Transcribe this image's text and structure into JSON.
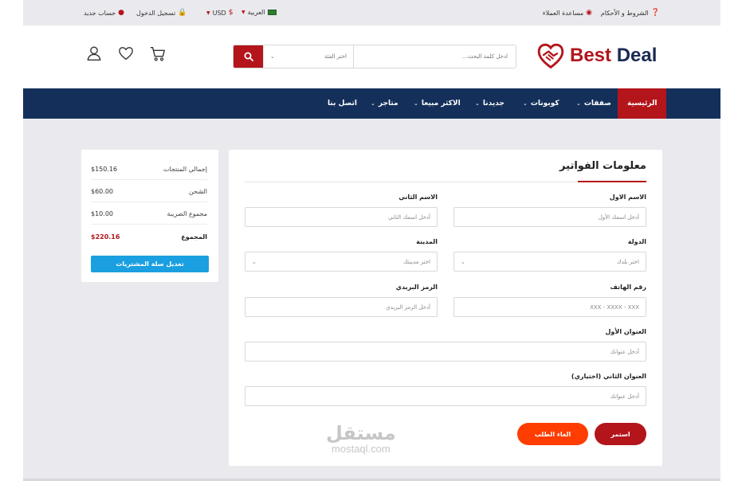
{
  "topbar": {
    "terms": "الشروط و الأحكام",
    "support": "مساعدة العملاء",
    "language": "العربية",
    "currency": "USD",
    "login": "تسجيل الدخول",
    "register": "حساب جديد"
  },
  "header": {
    "logo_best": "Best",
    "logo_deal": "Deal",
    "search_placeholder": "ادخل كلمة البحث...",
    "category_placeholder": "اختر الفئة"
  },
  "nav": {
    "items": [
      {
        "label": "الرئيسية"
      },
      {
        "label": "صفقات"
      },
      {
        "label": "كوبونات"
      },
      {
        "label": "جديدنا"
      },
      {
        "label": "الاكثر مبيعا"
      },
      {
        "label": "متاجر"
      },
      {
        "label": "اتصل بنا"
      }
    ]
  },
  "summary": {
    "products_label": "إجمالي المنتجات",
    "products_value": "$150.16",
    "shipping_label": "الشحن",
    "shipping_value": "$60.00",
    "tax_label": "مجموع الضريبة",
    "tax_value": "$10.00",
    "total_label": "المجموع",
    "total_value": "$220.16",
    "edit_button": "تعديل سلة المشتريات"
  },
  "billing": {
    "title": "معلومات الفواتير",
    "first_name_label": "الاسم الاول",
    "first_name_placeholder": "أدخل اسمك الأول",
    "last_name_label": "الاسم الثاني",
    "last_name_placeholder": "أدخل اسمك الثاني",
    "country_label": "الدولة",
    "country_placeholder": "اختر بلدك",
    "city_label": "المدينة",
    "city_placeholder": "اختر مدينتك",
    "phone_label": "رقم الهاتف",
    "phone_placeholder": "XXX - XXXX - XXX",
    "zip_label": "الرمز البريدي",
    "zip_placeholder": "أدخل الرمز البريدي",
    "address1_label": "العنوان الأول",
    "address1_placeholder": "أدخل عنوانك",
    "address2_label": "العنوان الثاني (اختياري)",
    "address2_placeholder": "أدخل عنوانك",
    "continue_button": "استمر",
    "cancel_button": "الغاء الطلب"
  },
  "watermark": {
    "arabic": "مستقل",
    "latin": "mostaql.com"
  },
  "colors": {
    "brand_red": "#b3151b",
    "navy": "#14305a",
    "cancel_orange": "#ff3d00",
    "accent_blue": "#1a9fe0"
  }
}
